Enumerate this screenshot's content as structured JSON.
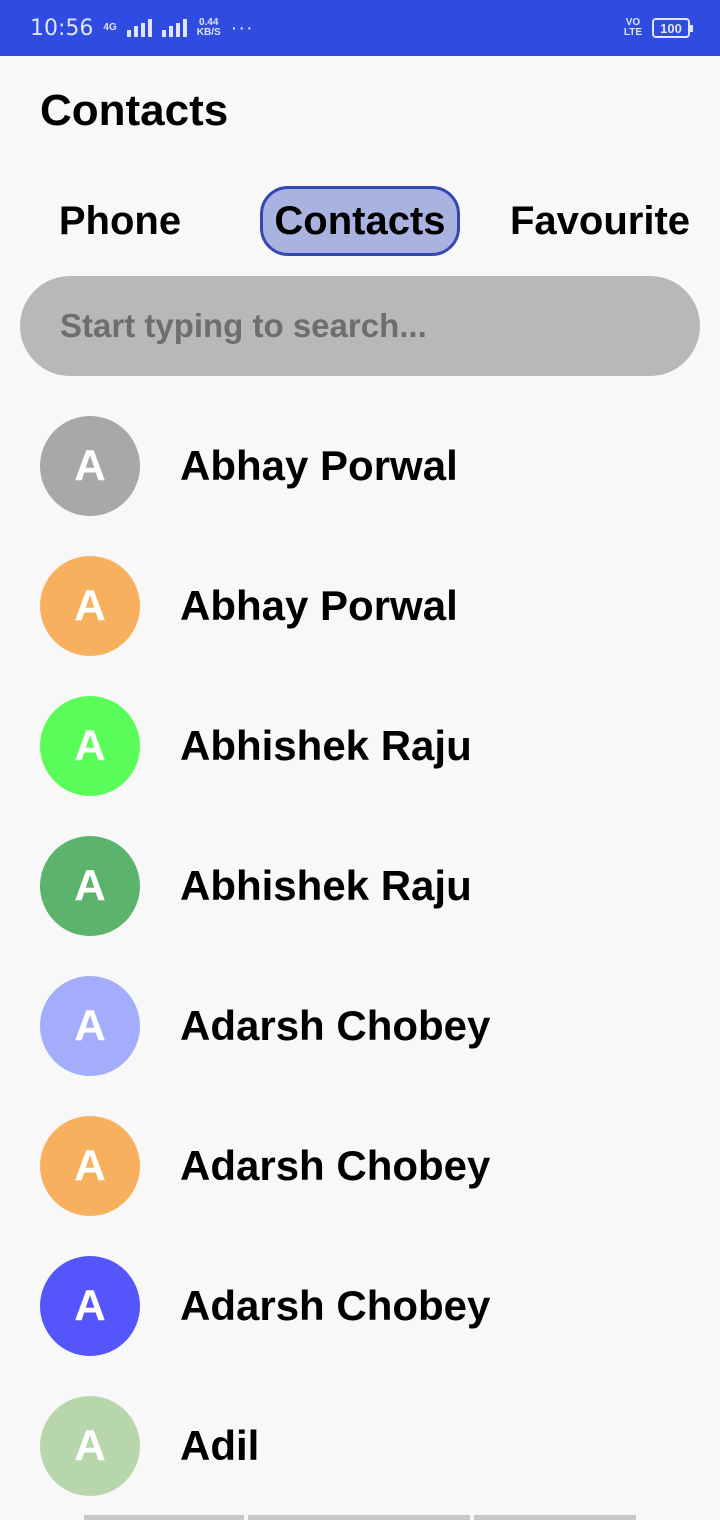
{
  "status_bar": {
    "time": "10:56",
    "net_type": "4G",
    "speed_value": "0.44",
    "speed_unit": "KB/S",
    "more": "···",
    "volte_top": "VO",
    "volte_bottom": "LTE",
    "battery": "100",
    "background": "#2f4be0"
  },
  "header": {
    "title": "Contacts"
  },
  "tabs": [
    {
      "label": "Phone",
      "active": false
    },
    {
      "label": "Contacts",
      "active": true
    },
    {
      "label": "Favourite",
      "active": false
    }
  ],
  "search": {
    "placeholder": "Start typing to search...",
    "value": ""
  },
  "contacts": [
    {
      "initial": "A",
      "name": "Abhay Porwal",
      "color": "#a8a8a8"
    },
    {
      "initial": "A",
      "name": "Abhay Porwal",
      "color": "#f7b15e"
    },
    {
      "initial": "A",
      "name": "Abhishek Raju",
      "color": "#5afc5a"
    },
    {
      "initial": "A",
      "name": "Abhishek Raju",
      "color": "#5cb46c"
    },
    {
      "initial": "A",
      "name": "Adarsh Chobey",
      "color": "#a4acfc"
    },
    {
      "initial": "A",
      "name": "Adarsh Chobey",
      "color": "#f7b15e"
    },
    {
      "initial": "A",
      "name": "Adarsh Chobey",
      "color": "#5456fc"
    },
    {
      "initial": "A",
      "name": "Adil",
      "color": "#b8d6ac"
    }
  ]
}
